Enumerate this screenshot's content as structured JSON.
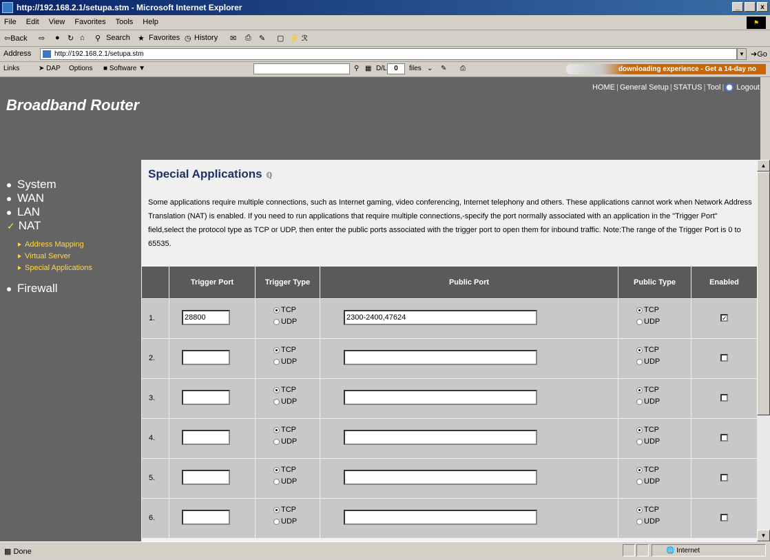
{
  "window": {
    "title": "http://192.168.2.1/setupa.stm - Microsoft Internet Explorer",
    "min": "_",
    "max": " ",
    "close": "x"
  },
  "menu": [
    "File",
    "Edit",
    "View",
    "Favorites",
    "Tools",
    "Help"
  ],
  "toolbar": {
    "back": "⇦Back",
    "forward": "⇨",
    "search": "Search",
    "favorites": "Favorites",
    "history": "History"
  },
  "address": {
    "label": "Address",
    "url": "http://192.168.2.1/setupa.stm",
    "go": "Go"
  },
  "links": {
    "label": "Links",
    "dap": "DAP",
    "options": "Options",
    "software": "Software",
    "dl": "D/L",
    "count": "0",
    "files": "files",
    "promo": "downloading experience - Get a 14-day no"
  },
  "header": {
    "brand": "Broadband Router",
    "nav": [
      {
        "label": "HOME"
      },
      {
        "label": "General Setup"
      },
      {
        "label": "STATUS"
      },
      {
        "label": "Tool"
      },
      {
        "label": "Logout"
      }
    ]
  },
  "sidebar": {
    "main": [
      "System",
      "WAN",
      "LAN",
      "NAT",
      "Firewall"
    ],
    "sub": [
      "Address Mapping",
      "Virtual Server",
      "Special Applications"
    ]
  },
  "page": {
    "title": "Special Applications",
    "help_icon": "help-icon",
    "description": "Some applications require multiple connections, such as Internet gaming, video conferencing, Internet telephony and others. These applications cannot work when Network Address Translation (NAT) is enabled. If you need to run applications that require multiple connections,-specify the port normally associated with an application in the \"Trigger Port\" field,select the protocol type as TCP or UDP, then enter the public ports associated with the trigger port to open them for inbound traffic. Note:The range of the Trigger Port is 0 to 65535."
  },
  "table": {
    "headers": [
      "",
      "Trigger Port",
      "Trigger Type",
      "Public Port",
      "Public Type",
      "Enabled"
    ],
    "tcp": "TCP",
    "udp": "UDP",
    "rows": [
      {
        "num": "1.",
        "trigger": "28800",
        "public": "2300-2400,47624",
        "enabled": "✓"
      },
      {
        "num": "2.",
        "trigger": "",
        "public": "",
        "enabled": ""
      },
      {
        "num": "3.",
        "trigger": "",
        "public": "",
        "enabled": ""
      },
      {
        "num": "4.",
        "trigger": "",
        "public": "",
        "enabled": ""
      },
      {
        "num": "5.",
        "trigger": "",
        "public": "",
        "enabled": ""
      },
      {
        "num": "6.",
        "trigger": "",
        "public": "",
        "enabled": ""
      }
    ]
  },
  "status": {
    "text": "Done",
    "zone": "Internet"
  }
}
